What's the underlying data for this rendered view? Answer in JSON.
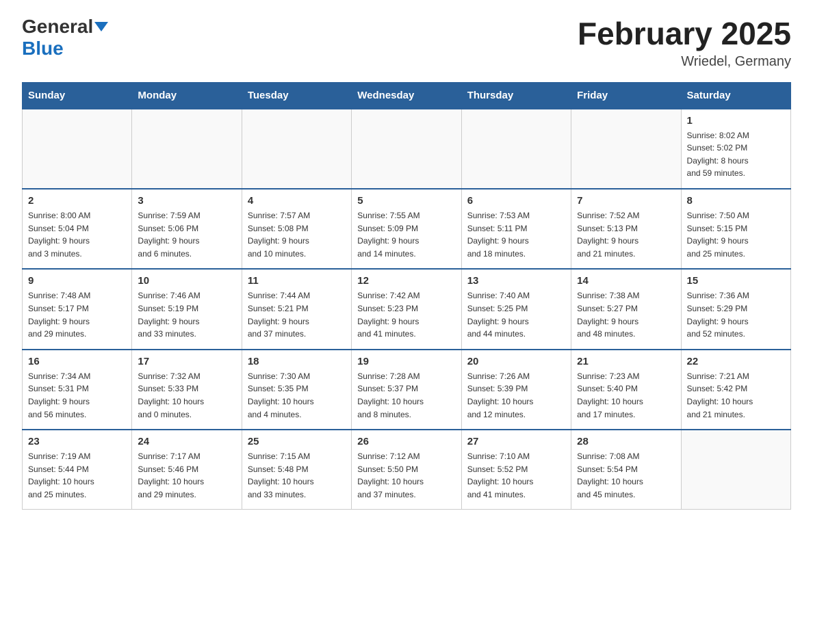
{
  "header": {
    "logo_general": "General",
    "logo_blue": "Blue",
    "month_year": "February 2025",
    "location": "Wriedel, Germany"
  },
  "weekdays": [
    "Sunday",
    "Monday",
    "Tuesday",
    "Wednesday",
    "Thursday",
    "Friday",
    "Saturday"
  ],
  "weeks": [
    [
      {
        "day": "",
        "info": ""
      },
      {
        "day": "",
        "info": ""
      },
      {
        "day": "",
        "info": ""
      },
      {
        "day": "",
        "info": ""
      },
      {
        "day": "",
        "info": ""
      },
      {
        "day": "",
        "info": ""
      },
      {
        "day": "1",
        "info": "Sunrise: 8:02 AM\nSunset: 5:02 PM\nDaylight: 8 hours\nand 59 minutes."
      }
    ],
    [
      {
        "day": "2",
        "info": "Sunrise: 8:00 AM\nSunset: 5:04 PM\nDaylight: 9 hours\nand 3 minutes."
      },
      {
        "day": "3",
        "info": "Sunrise: 7:59 AM\nSunset: 5:06 PM\nDaylight: 9 hours\nand 6 minutes."
      },
      {
        "day": "4",
        "info": "Sunrise: 7:57 AM\nSunset: 5:08 PM\nDaylight: 9 hours\nand 10 minutes."
      },
      {
        "day": "5",
        "info": "Sunrise: 7:55 AM\nSunset: 5:09 PM\nDaylight: 9 hours\nand 14 minutes."
      },
      {
        "day": "6",
        "info": "Sunrise: 7:53 AM\nSunset: 5:11 PM\nDaylight: 9 hours\nand 18 minutes."
      },
      {
        "day": "7",
        "info": "Sunrise: 7:52 AM\nSunset: 5:13 PM\nDaylight: 9 hours\nand 21 minutes."
      },
      {
        "day": "8",
        "info": "Sunrise: 7:50 AM\nSunset: 5:15 PM\nDaylight: 9 hours\nand 25 minutes."
      }
    ],
    [
      {
        "day": "9",
        "info": "Sunrise: 7:48 AM\nSunset: 5:17 PM\nDaylight: 9 hours\nand 29 minutes."
      },
      {
        "day": "10",
        "info": "Sunrise: 7:46 AM\nSunset: 5:19 PM\nDaylight: 9 hours\nand 33 minutes."
      },
      {
        "day": "11",
        "info": "Sunrise: 7:44 AM\nSunset: 5:21 PM\nDaylight: 9 hours\nand 37 minutes."
      },
      {
        "day": "12",
        "info": "Sunrise: 7:42 AM\nSunset: 5:23 PM\nDaylight: 9 hours\nand 41 minutes."
      },
      {
        "day": "13",
        "info": "Sunrise: 7:40 AM\nSunset: 5:25 PM\nDaylight: 9 hours\nand 44 minutes."
      },
      {
        "day": "14",
        "info": "Sunrise: 7:38 AM\nSunset: 5:27 PM\nDaylight: 9 hours\nand 48 minutes."
      },
      {
        "day": "15",
        "info": "Sunrise: 7:36 AM\nSunset: 5:29 PM\nDaylight: 9 hours\nand 52 minutes."
      }
    ],
    [
      {
        "day": "16",
        "info": "Sunrise: 7:34 AM\nSunset: 5:31 PM\nDaylight: 9 hours\nand 56 minutes."
      },
      {
        "day": "17",
        "info": "Sunrise: 7:32 AM\nSunset: 5:33 PM\nDaylight: 10 hours\nand 0 minutes."
      },
      {
        "day": "18",
        "info": "Sunrise: 7:30 AM\nSunset: 5:35 PM\nDaylight: 10 hours\nand 4 minutes."
      },
      {
        "day": "19",
        "info": "Sunrise: 7:28 AM\nSunset: 5:37 PM\nDaylight: 10 hours\nand 8 minutes."
      },
      {
        "day": "20",
        "info": "Sunrise: 7:26 AM\nSunset: 5:39 PM\nDaylight: 10 hours\nand 12 minutes."
      },
      {
        "day": "21",
        "info": "Sunrise: 7:23 AM\nSunset: 5:40 PM\nDaylight: 10 hours\nand 17 minutes."
      },
      {
        "day": "22",
        "info": "Sunrise: 7:21 AM\nSunset: 5:42 PM\nDaylight: 10 hours\nand 21 minutes."
      }
    ],
    [
      {
        "day": "23",
        "info": "Sunrise: 7:19 AM\nSunset: 5:44 PM\nDaylight: 10 hours\nand 25 minutes."
      },
      {
        "day": "24",
        "info": "Sunrise: 7:17 AM\nSunset: 5:46 PM\nDaylight: 10 hours\nand 29 minutes."
      },
      {
        "day": "25",
        "info": "Sunrise: 7:15 AM\nSunset: 5:48 PM\nDaylight: 10 hours\nand 33 minutes."
      },
      {
        "day": "26",
        "info": "Sunrise: 7:12 AM\nSunset: 5:50 PM\nDaylight: 10 hours\nand 37 minutes."
      },
      {
        "day": "27",
        "info": "Sunrise: 7:10 AM\nSunset: 5:52 PM\nDaylight: 10 hours\nand 41 minutes."
      },
      {
        "day": "28",
        "info": "Sunrise: 7:08 AM\nSunset: 5:54 PM\nDaylight: 10 hours\nand 45 minutes."
      },
      {
        "day": "",
        "info": ""
      }
    ]
  ]
}
